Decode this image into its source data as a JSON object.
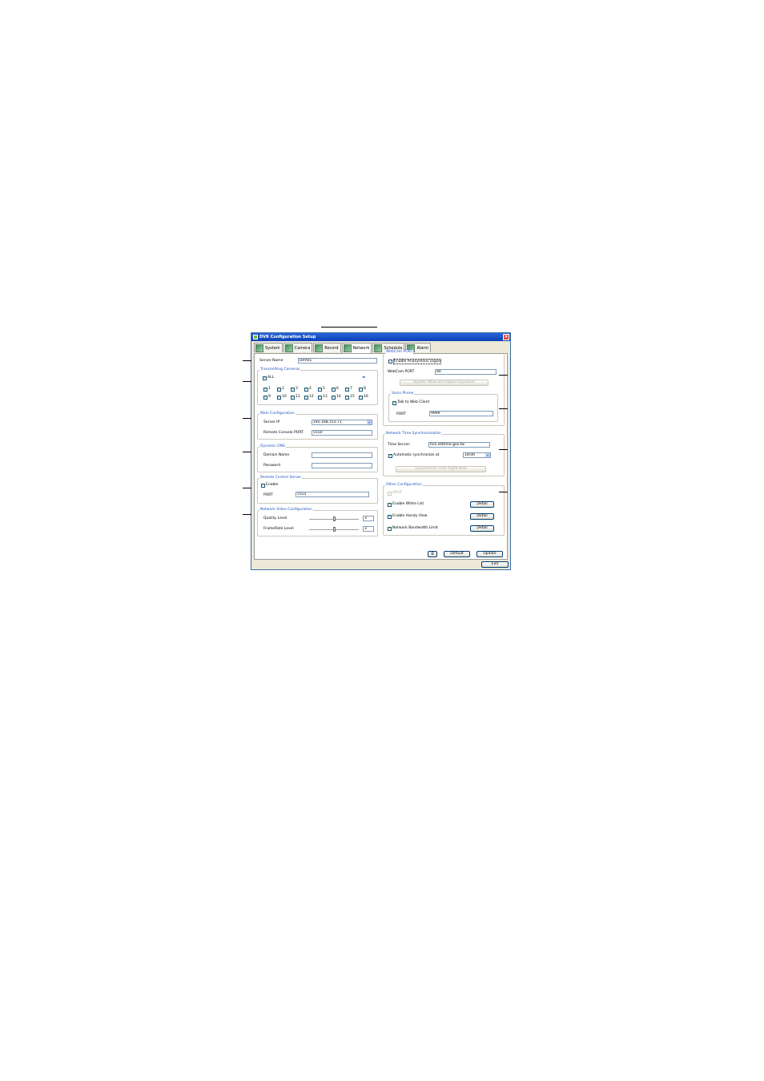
{
  "window": {
    "title": "DVR Configuration Setup"
  },
  "tabs": [
    {
      "label": "System"
    },
    {
      "label": "Camera"
    },
    {
      "label": "Record"
    },
    {
      "label": "Network"
    },
    {
      "label": "Schedule"
    },
    {
      "label": "Alarm"
    }
  ],
  "server_name": {
    "label": "Server Name",
    "value": "DVR01"
  },
  "transmitting_cameras": {
    "title": "Transmitting Cameras",
    "all_label": "ALL",
    "all_checked": true,
    "cameras": [
      "1",
      "2",
      "3",
      "4",
      "5",
      "6",
      "7",
      "8",
      "9",
      "10",
      "11",
      "12",
      "13",
      "14",
      "15",
      "16"
    ]
  },
  "main_configuration": {
    "title": "Main Configuration",
    "server_ip_label": "Server IP",
    "server_ip_value": "192.168.153.71",
    "console_port_label": "Remote Console PORT",
    "console_port_value": "5550"
  },
  "dynamic_dns": {
    "title": "Dynamic DNS",
    "domain_label": "Domain Name",
    "domain_value": "",
    "password_label": "Password",
    "password_value": ""
  },
  "remote_control_server": {
    "title": "Remote Control Server",
    "enable_label": "Enable",
    "enable_checked": true,
    "port_label": "PORT",
    "port_value": "5555"
  },
  "network_video": {
    "title": "Network Video Configuration",
    "quality_label": "Quality Level",
    "quality_value": "3",
    "quality_level": 0.5,
    "framerate_label": "FrameRate Level",
    "framerate_value": "3",
    "framerate_level": 0.5
  },
  "webcam_port": {
    "title": "WebCam PORT",
    "anon_label": "Enable Anonymous Logon",
    "anon_checked": false,
    "port_label": "WebCam PORT",
    "port_value": "80",
    "update_signature_label": "Update WebCam Digital Signature"
  },
  "voice_phone": {
    "title": "Voice Phone",
    "talk_label": "Talk to Web Client",
    "talk_checked": true,
    "port_label": "PORT",
    "port_value": "9999"
  },
  "time_sync": {
    "title": "Network Time Synchronization",
    "server_label": "Time Server:",
    "server_value": "tick.stdtime.gov.tw",
    "auto_label": "Automatic synchronize at",
    "auto_checked": true,
    "auto_time": "18:00",
    "sync_now_label": "Synchronize Time Right Now"
  },
  "other_configuration": {
    "title": "Other Configuration",
    "upnp_label": "UPnP",
    "white_list_label": "Enable White List",
    "handy_view_label": "Enable Handy View",
    "bandwidth_label": "Network Bandwidth Limit",
    "detail_label": "Detail"
  },
  "footer": {
    "default_label": "Default",
    "update_label": "Update",
    "exit_label": "Exit"
  },
  "colors": {
    "title_bar": "#0a3fb6",
    "group_title": "#2255bb",
    "check": "#21a121"
  }
}
